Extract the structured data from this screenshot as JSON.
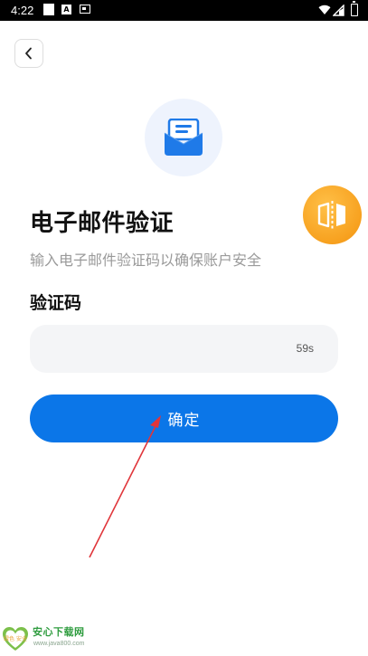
{
  "status_bar": {
    "time": "4:22",
    "icons": [
      "notification-square-icon",
      "a-app-icon",
      "sim-card-icon",
      "wifi-icon",
      "signal-icon",
      "battery-icon"
    ]
  },
  "header": {
    "back_icon": "chevron-left-icon"
  },
  "hero": {
    "icon": "mail-icon",
    "accent_bg": "#eef3fd",
    "accent_color": "#1f7ae8"
  },
  "floating_widget": {
    "icon": "mirror-split-icon",
    "color": "#f7a11f"
  },
  "page": {
    "title": "电子邮件验证",
    "subtitle": "输入电子邮件验证码以确保账户安全"
  },
  "form": {
    "code_label": "验证码",
    "code_value": "",
    "countdown": "59s",
    "confirm_label": "确定"
  },
  "colors": {
    "primary": "#0b76e8",
    "annotation_arrow": "#e0353a"
  },
  "watermark": {
    "title": "安心下载网",
    "url": "www.java800.com",
    "logo_text": "绿色 安全"
  }
}
